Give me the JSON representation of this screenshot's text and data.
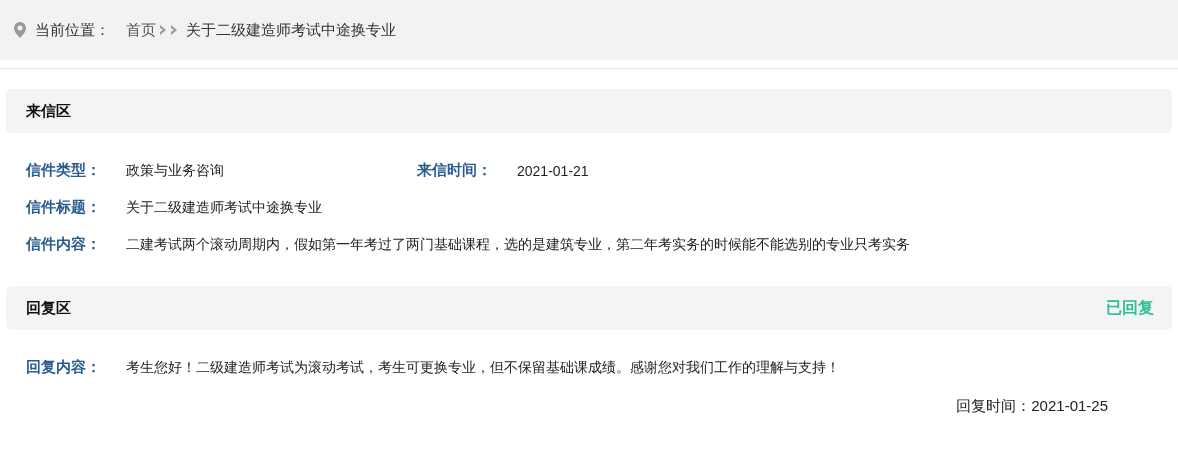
{
  "breadcrumb": {
    "label": "当前位置：",
    "items": [
      {
        "text": "首页",
        "kind": "link"
      },
      {
        "text": "关于二级建造师考试中途换专业",
        "kind": "current"
      }
    ]
  },
  "letter": {
    "title": "来信区",
    "rows": [
      [
        {
          "label": "信件类型：",
          "value": "政策与业务咨询"
        },
        {
          "label": "来信时间：",
          "value": "2021-01-21"
        }
      ],
      [
        {
          "label": "信件标题：",
          "value": "关于二级建造师考试中途换专业"
        }
      ],
      [
        {
          "label": "信件内容：",
          "value": "二建考试两个滚动周期内，假如第一年考过了两门基础课程，选的是建筑专业，第二年考实务的时候能不能选别的专业只考实务"
        }
      ]
    ]
  },
  "reply": {
    "title": "回复区",
    "status": "已回复",
    "rows": [
      [
        {
          "label": "回复内容：",
          "value": "考生您好！二级建造师考试为滚动考试，考生可更换专业，但不保留基础课成绩。感谢您对我们工作的理解与支持！"
        }
      ]
    ],
    "time": "回复时间：2021-01-25"
  }
}
